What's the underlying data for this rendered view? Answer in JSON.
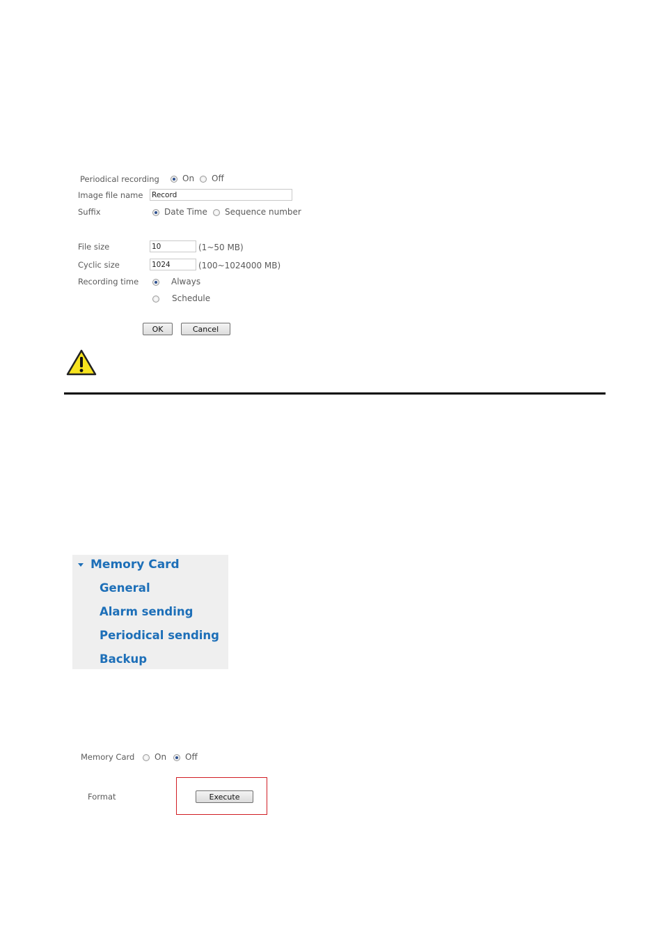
{
  "periodical_form": {
    "periodical_recording_label": "Periodical recording",
    "on_label": "On",
    "off_label": "Off",
    "periodical_recording_value": "On",
    "image_file_name_label": "Image file name",
    "image_file_name_value": "Record",
    "suffix_label": "Suffix",
    "suffix_date_time_label": "Date Time",
    "suffix_sequence_label": "Sequence number",
    "suffix_value": "Date Time",
    "file_size_label": "File size",
    "file_size_value": "10",
    "file_size_range": "(1~50 MB)",
    "cyclic_size_label": "Cyclic size",
    "cyclic_size_value": "1024",
    "cyclic_size_range": "(100~1024000 MB)",
    "recording_time_label": "Recording time",
    "always_label": "Always",
    "schedule_label": "Schedule",
    "recording_time_value": "Always",
    "ok_label": "OK",
    "cancel_label": "Cancel"
  },
  "warning_icon": "warning-triangle-icon",
  "menu": {
    "title": "Memory Card",
    "items": [
      {
        "label": "General"
      },
      {
        "label": "Alarm sending"
      },
      {
        "label": "Periodical sending"
      },
      {
        "label": "Backup"
      }
    ]
  },
  "memory_card_form": {
    "memory_card_label": "Memory Card",
    "on_label": "On",
    "off_label": "Off",
    "memory_card_value": "Off",
    "format_label": "Format",
    "execute_label": "Execute"
  },
  "colors": {
    "menu_text": "#1d6fb8",
    "menu_background": "#efefef",
    "highlight_border": "#d01c23",
    "radio_selected": "#2c4f8e",
    "warning_fill": "#f7e31e"
  }
}
